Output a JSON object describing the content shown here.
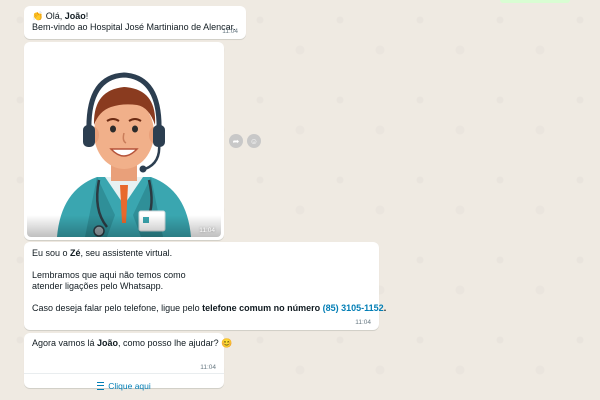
{
  "chat": {
    "messages": [
      {
        "greeting_emoji": "👏",
        "greeting_pre": "Olá, ",
        "greeting_name": "João",
        "greeting_post": "!",
        "welcome": "Bem-vindo ao  Hospital José Martiniano de Alencar.",
        "time": "11:04"
      },
      {
        "image_description": "assistant-avatar",
        "time": "11:04"
      },
      {
        "intro_pre": "Eu sou o ",
        "intro_name": "Zé",
        "intro_post": ", seu assistente virtual.",
        "reminder_line1": "Lembramos que aqui  não temos como",
        "reminder_line2": "atender ligações pelo Whatsapp.",
        "phone_pre": "Caso deseja falar pelo telefone, ligue pelo ",
        "phone_bold": "telefone comum no número ",
        "phone_number": "(85) 3105-1152",
        "phone_post": ".",
        "time": "11:04"
      },
      {
        "question_pre": "Agora vamos lá ",
        "question_name": "João",
        "question_post": ", como posso lhe ajudar? ",
        "question_emoji": "😊",
        "time": "11:04",
        "action_label": "Clique aqui",
        "action_icon": "list-icon"
      }
    ]
  },
  "colors": {
    "background": "#efeae2",
    "bubble": "#ffffff",
    "link": "#027eb5",
    "meta": "#667781"
  }
}
